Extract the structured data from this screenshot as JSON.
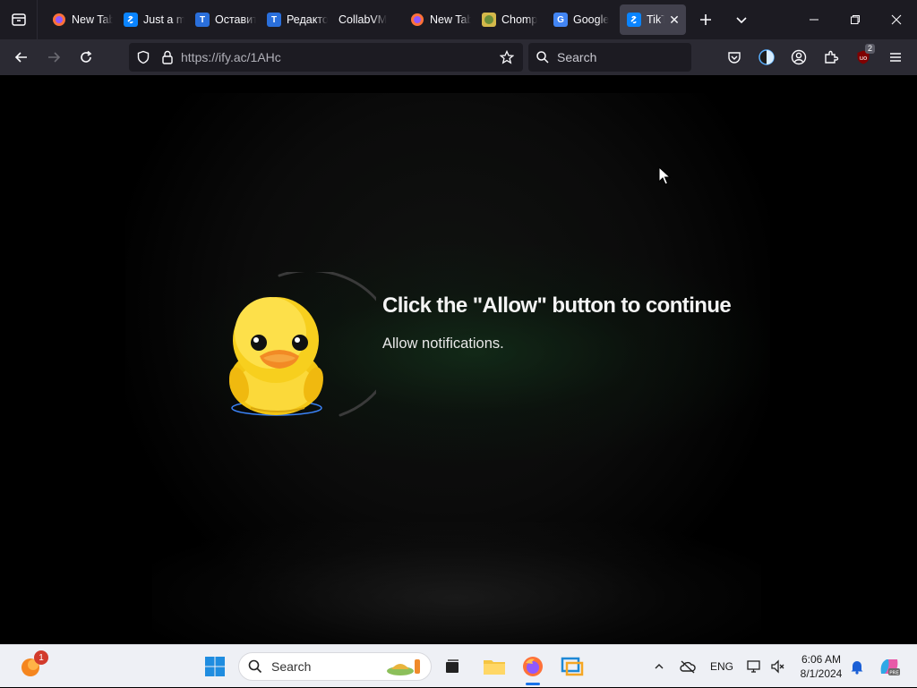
{
  "browser": {
    "tabs": [
      {
        "label": "New Tab",
        "favicon": "firefox-icon",
        "color": "#ff7139"
      },
      {
        "label": "Just a moment",
        "favicon": "link-icon",
        "color": "#0a84ff"
      },
      {
        "label": "Оставить",
        "favicon": "telegraph-icon",
        "color": "#2a6fdb"
      },
      {
        "label": "Редактор",
        "favicon": "telegraph-icon",
        "color": "#2a6fdb"
      },
      {
        "label": "CollabVM",
        "favicon": "none"
      },
      {
        "label": "New Tab",
        "favicon": "firefox-icon",
        "color": "#ff7139"
      },
      {
        "label": "Chomp",
        "favicon": "chomp-icon",
        "color": "#d4b84a"
      },
      {
        "label": "Google",
        "favicon": "google-translate-icon",
        "color": "#4285f4"
      },
      {
        "label": "TikTok",
        "favicon": "link-icon",
        "color": "#0a84ff",
        "active": true
      }
    ],
    "url": "https://ify.ac/1AHc",
    "search_placeholder": "Search",
    "extension_badge": "2"
  },
  "page": {
    "headline": "Click the \"Allow\" button to continue",
    "subline": "Allow notifications."
  },
  "taskbar": {
    "search_placeholder": "Search",
    "notification_badge": "1",
    "language": "ENG",
    "time": "6:06 AM",
    "date": "8/1/2024"
  }
}
